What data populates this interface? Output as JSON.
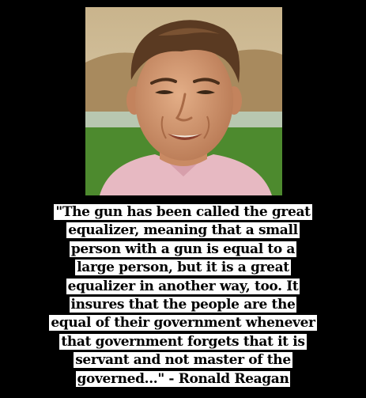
{
  "photo": {
    "icon": "portrait-photo",
    "colors": {
      "sky": "#d9c9a8",
      "hills": "#a88a5e",
      "grass": "#4d8a2e",
      "skin": "#d59a74",
      "hair": "#5a3a22",
      "shirt": "#e7b9c2"
    }
  },
  "quote": {
    "lines": [
      "\"The gun has been called the great",
      "equalizer, meaning that a small",
      "person with a gun is equal to a",
      "large person, but it is a great",
      "equalizer in another way, too. It",
      "insures that the people are the",
      "equal of their government whenever",
      "that government forgets that it is",
      "servant and not master of the",
      "governed...\" - Ronald Reagan"
    ]
  },
  "colors": {
    "background": "#000000",
    "text_box": "#ffffff",
    "text": "#000000"
  }
}
